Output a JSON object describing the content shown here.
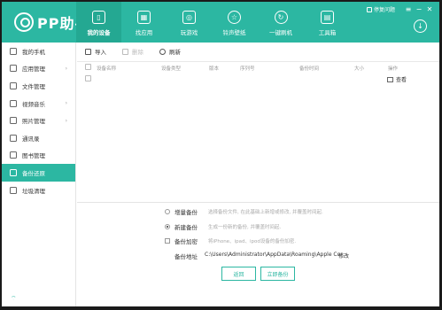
{
  "app": {
    "logo_text": "PP助手"
  },
  "nav": [
    {
      "label": "我的设备",
      "icon": "phone-icon",
      "active": true
    },
    {
      "label": "找应用",
      "icon": "apps-icon"
    },
    {
      "label": "玩游戏",
      "icon": "gamepad-icon"
    },
    {
      "label": "铃声壁纸",
      "icon": "star-icon"
    },
    {
      "label": "一键刷机",
      "icon": "refresh-icon"
    },
    {
      "label": "工具箱",
      "icon": "toolbox-icon"
    }
  ],
  "window": {
    "feedback": "停复问题"
  },
  "sidebar": [
    {
      "label": "我的手机",
      "icon": "phone-icon",
      "arrow": false
    },
    {
      "label": "应用管理",
      "icon": "apps-icon",
      "arrow": true
    },
    {
      "label": "文件管理",
      "icon": "folder-icon",
      "arrow": false
    },
    {
      "label": "视频音乐",
      "icon": "video-icon",
      "arrow": true
    },
    {
      "label": "照片管理",
      "icon": "photo-icon",
      "arrow": true
    },
    {
      "label": "通讯录",
      "icon": "contacts-icon",
      "arrow": false
    },
    {
      "label": "图书管理",
      "icon": "book-icon",
      "arrow": false
    },
    {
      "label": "备份还原",
      "icon": "backup-icon",
      "arrow": false,
      "active": true
    },
    {
      "label": "垃圾清理",
      "icon": "trash-icon",
      "arrow": false
    }
  ],
  "toolbar": {
    "import": "导入",
    "delete": "删除",
    "refresh": "刷新"
  },
  "table": {
    "columns": [
      "设备名称",
      "设备类型",
      "版本",
      "序列号",
      "备份时间",
      "大小",
      "操作"
    ],
    "row_action": "查看"
  },
  "backup_options": {
    "incremental": {
      "label": "增量备份",
      "desc": "选择备份文件, 在此基础上新增或修改, 并覆盖时间起."
    },
    "new": {
      "label": "新建备份",
      "desc": "生成一份新的备份, 并覆盖时间起."
    },
    "encrypt": {
      "label": "备份加密",
      "desc": "将iPhone、ipad、ipod设备的备份加密."
    },
    "path_label": "备份地址",
    "path_value": "C:\\Users\\Administrator\\AppData\\Roaming\\Apple Cor",
    "path_change": "修改"
  },
  "buttons": {
    "back": "返回",
    "start": "立即备份"
  }
}
